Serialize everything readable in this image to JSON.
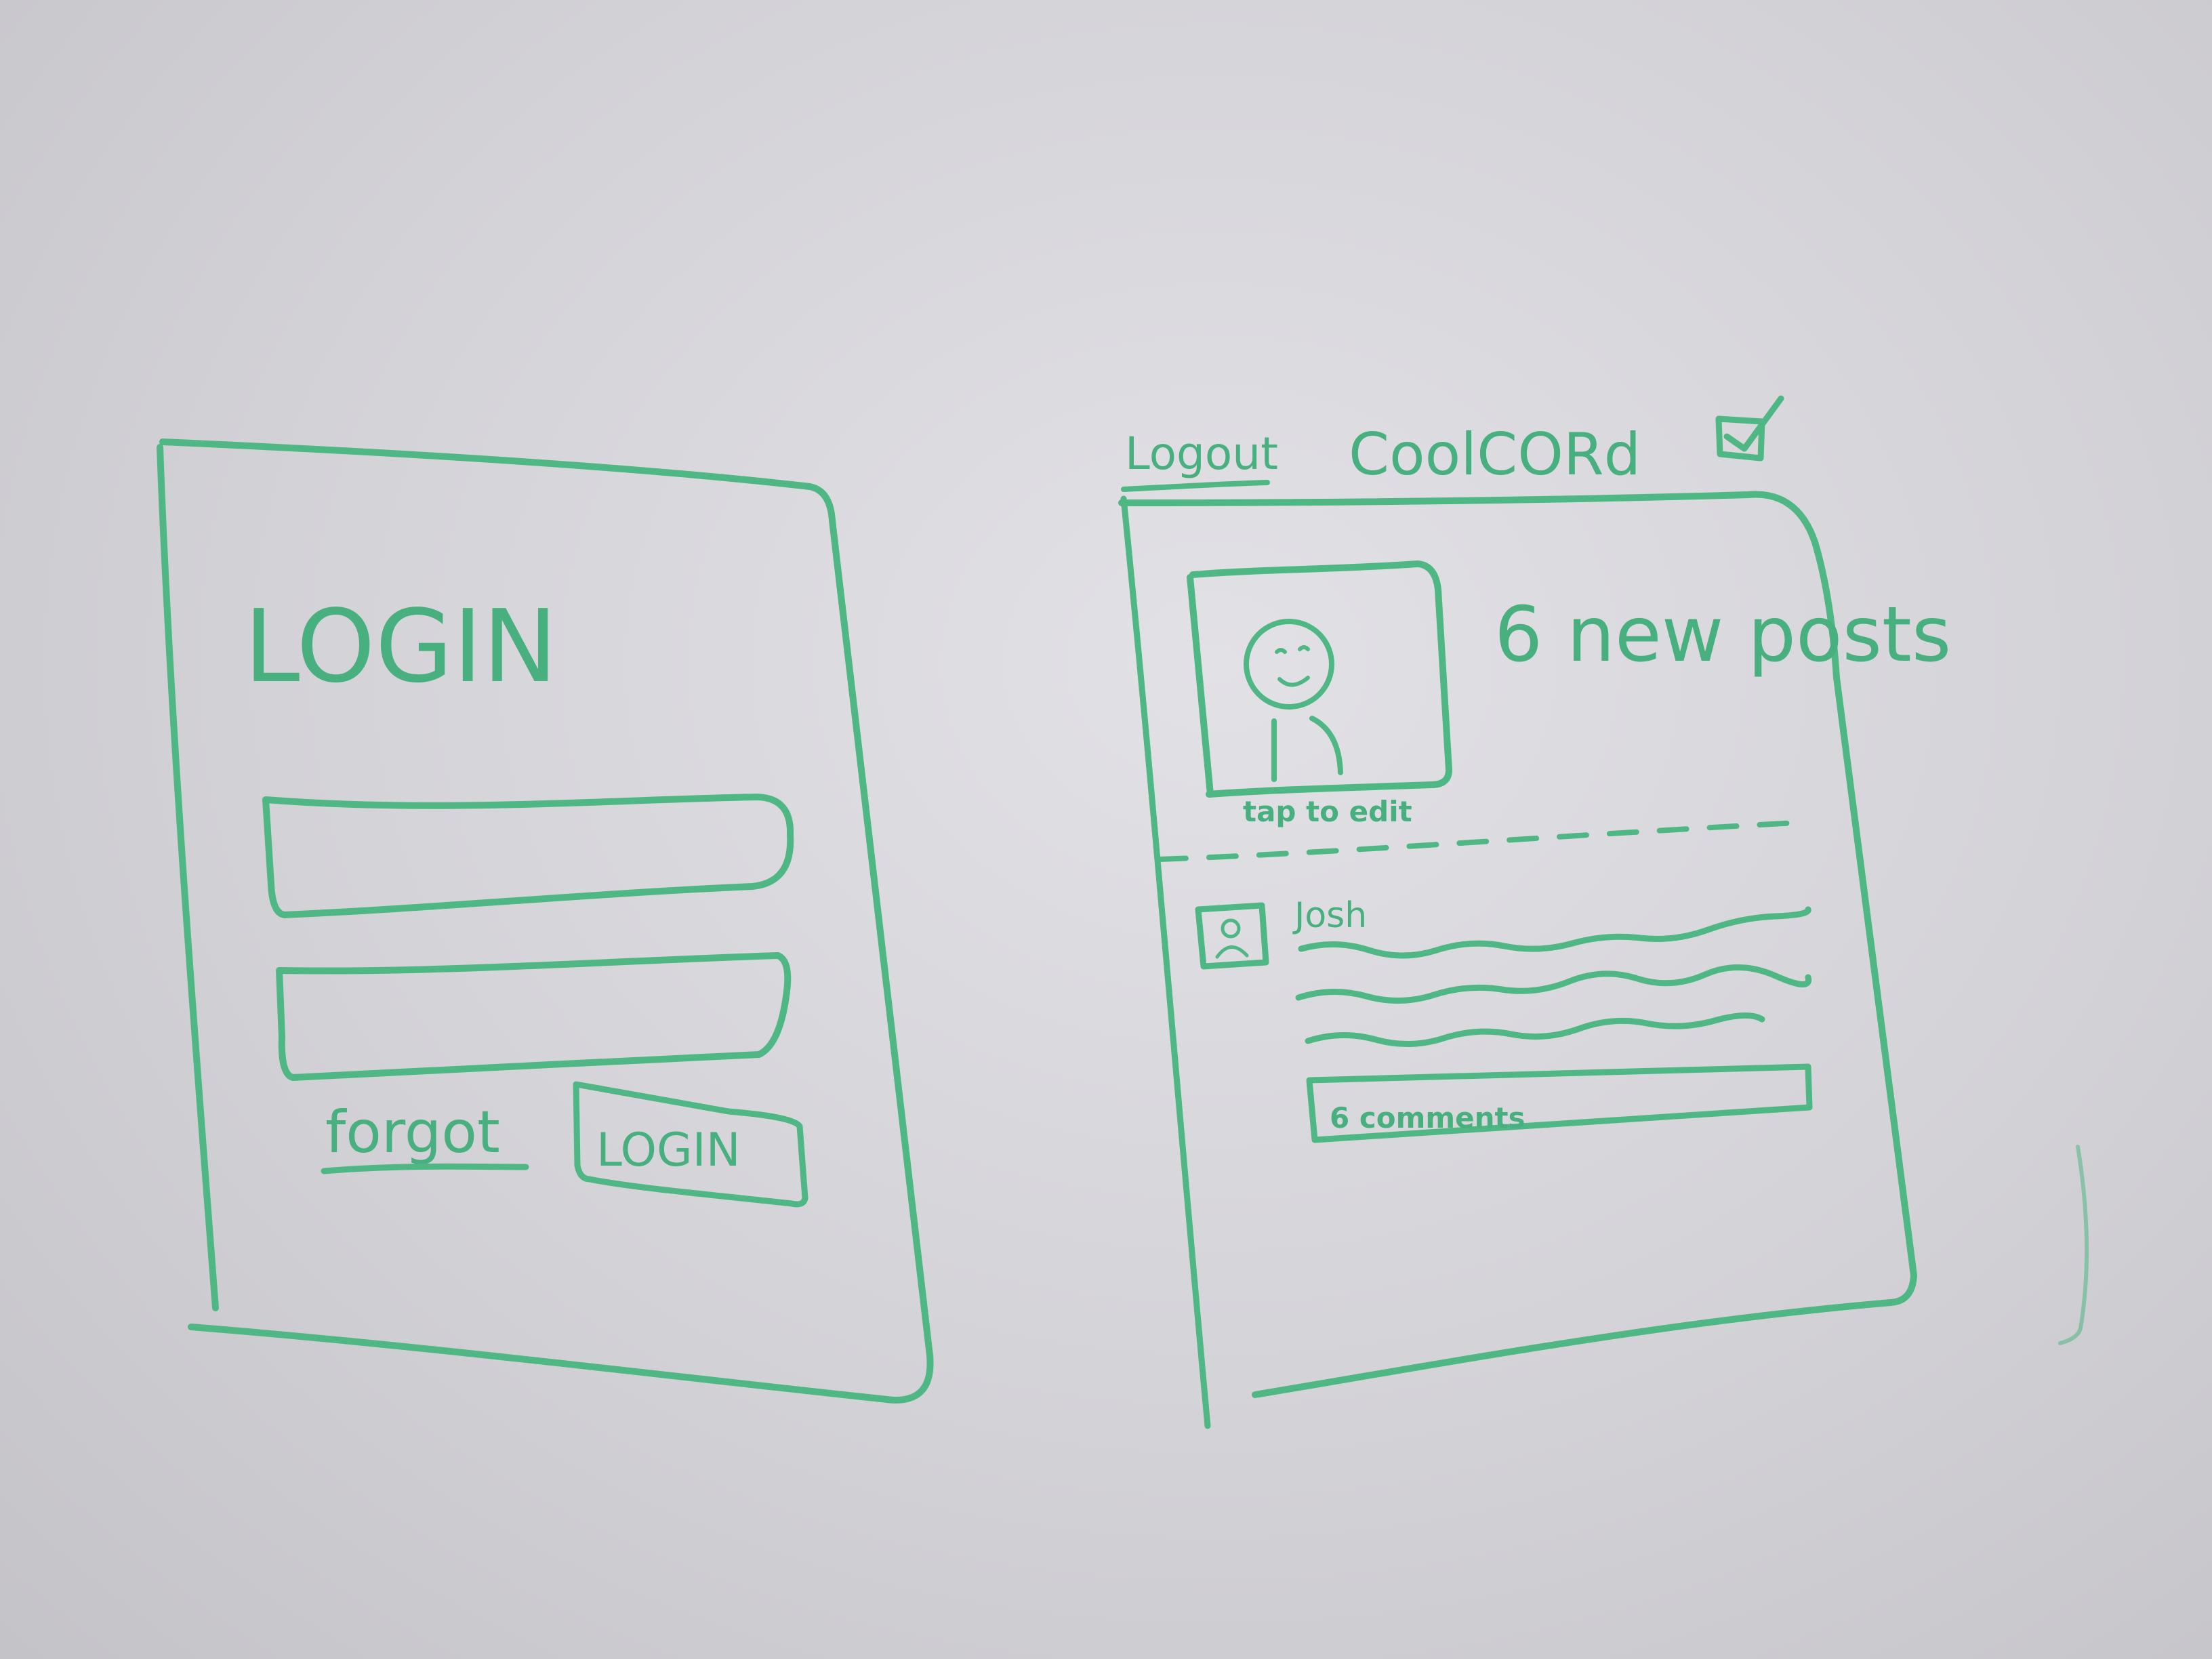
{
  "login_screen": {
    "title": "LOGIN",
    "forgot_link": "forgot",
    "login_button": "LOGIN",
    "username_value": "",
    "password_value": ""
  },
  "feed_screen": {
    "logout_link": "Logout",
    "app_title": "CoolCORd",
    "new_posts": "6 new posts",
    "tap_to_edit": "tap to edit",
    "post": {
      "author": "Josh",
      "comments_label": "6 comments"
    }
  },
  "colors": {
    "ink": "#4fb784",
    "board": "#dcdbe0"
  },
  "icons": {
    "compose": "compose-icon",
    "avatar": "user-avatar-icon"
  }
}
